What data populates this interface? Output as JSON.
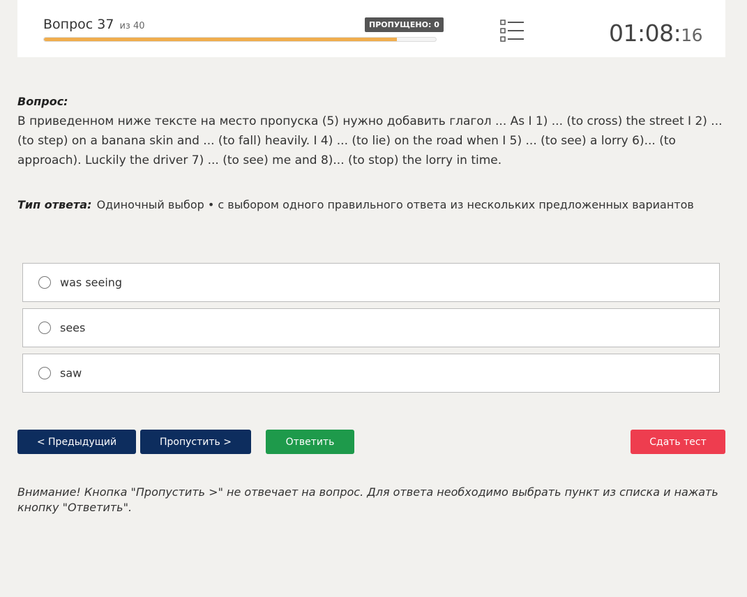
{
  "header": {
    "question_label": "Вопрос 37",
    "question_of": "из 40",
    "skipped_badge": "ПРОПУЩЕНО: 0",
    "progress_fraction": 0.9,
    "list_icon": "list-icon",
    "timer_main": "01:08:",
    "timer_seconds": "16"
  },
  "question": {
    "label": "Вопрос:",
    "text": "В приведенном ниже тексте на место пропуска (5) нужно добавить глагол ... As I 1) ... (to cross) the street I 2) ... (to step) on a banana skin and ... (to fall) heavily. I 4) ... (to lie) on the road when I 5) ... (to see) a lorry 6)... (to approach). Luckily the driver 7) ... (to see) me and 8)... (to stop) the lorry in time."
  },
  "answer_type": {
    "label": "Тип ответа:",
    "value": "Одиночный выбор • с выбором одного правильного ответа из нескольких предложенных вариантов"
  },
  "options": [
    {
      "label": "was seeing"
    },
    {
      "label": "sees"
    },
    {
      "label": "saw"
    }
  ],
  "buttons": {
    "prev": "< Предыдущий",
    "skip": "Пропустить >",
    "answer": "Ответить",
    "submit": "Сдать тест"
  },
  "notice": "Внимание! Кнопка \"Пропустить >\" не отвечает на вопрос. Для ответа необходимо выбрать пункт из списка и нажать кнопку \"Ответить\".",
  "colors": {
    "progress": "#f0ad4e",
    "nav_button": "#0d2d5e",
    "answer_button": "#1e9a4b",
    "submit_button": "#ee3d4f"
  }
}
